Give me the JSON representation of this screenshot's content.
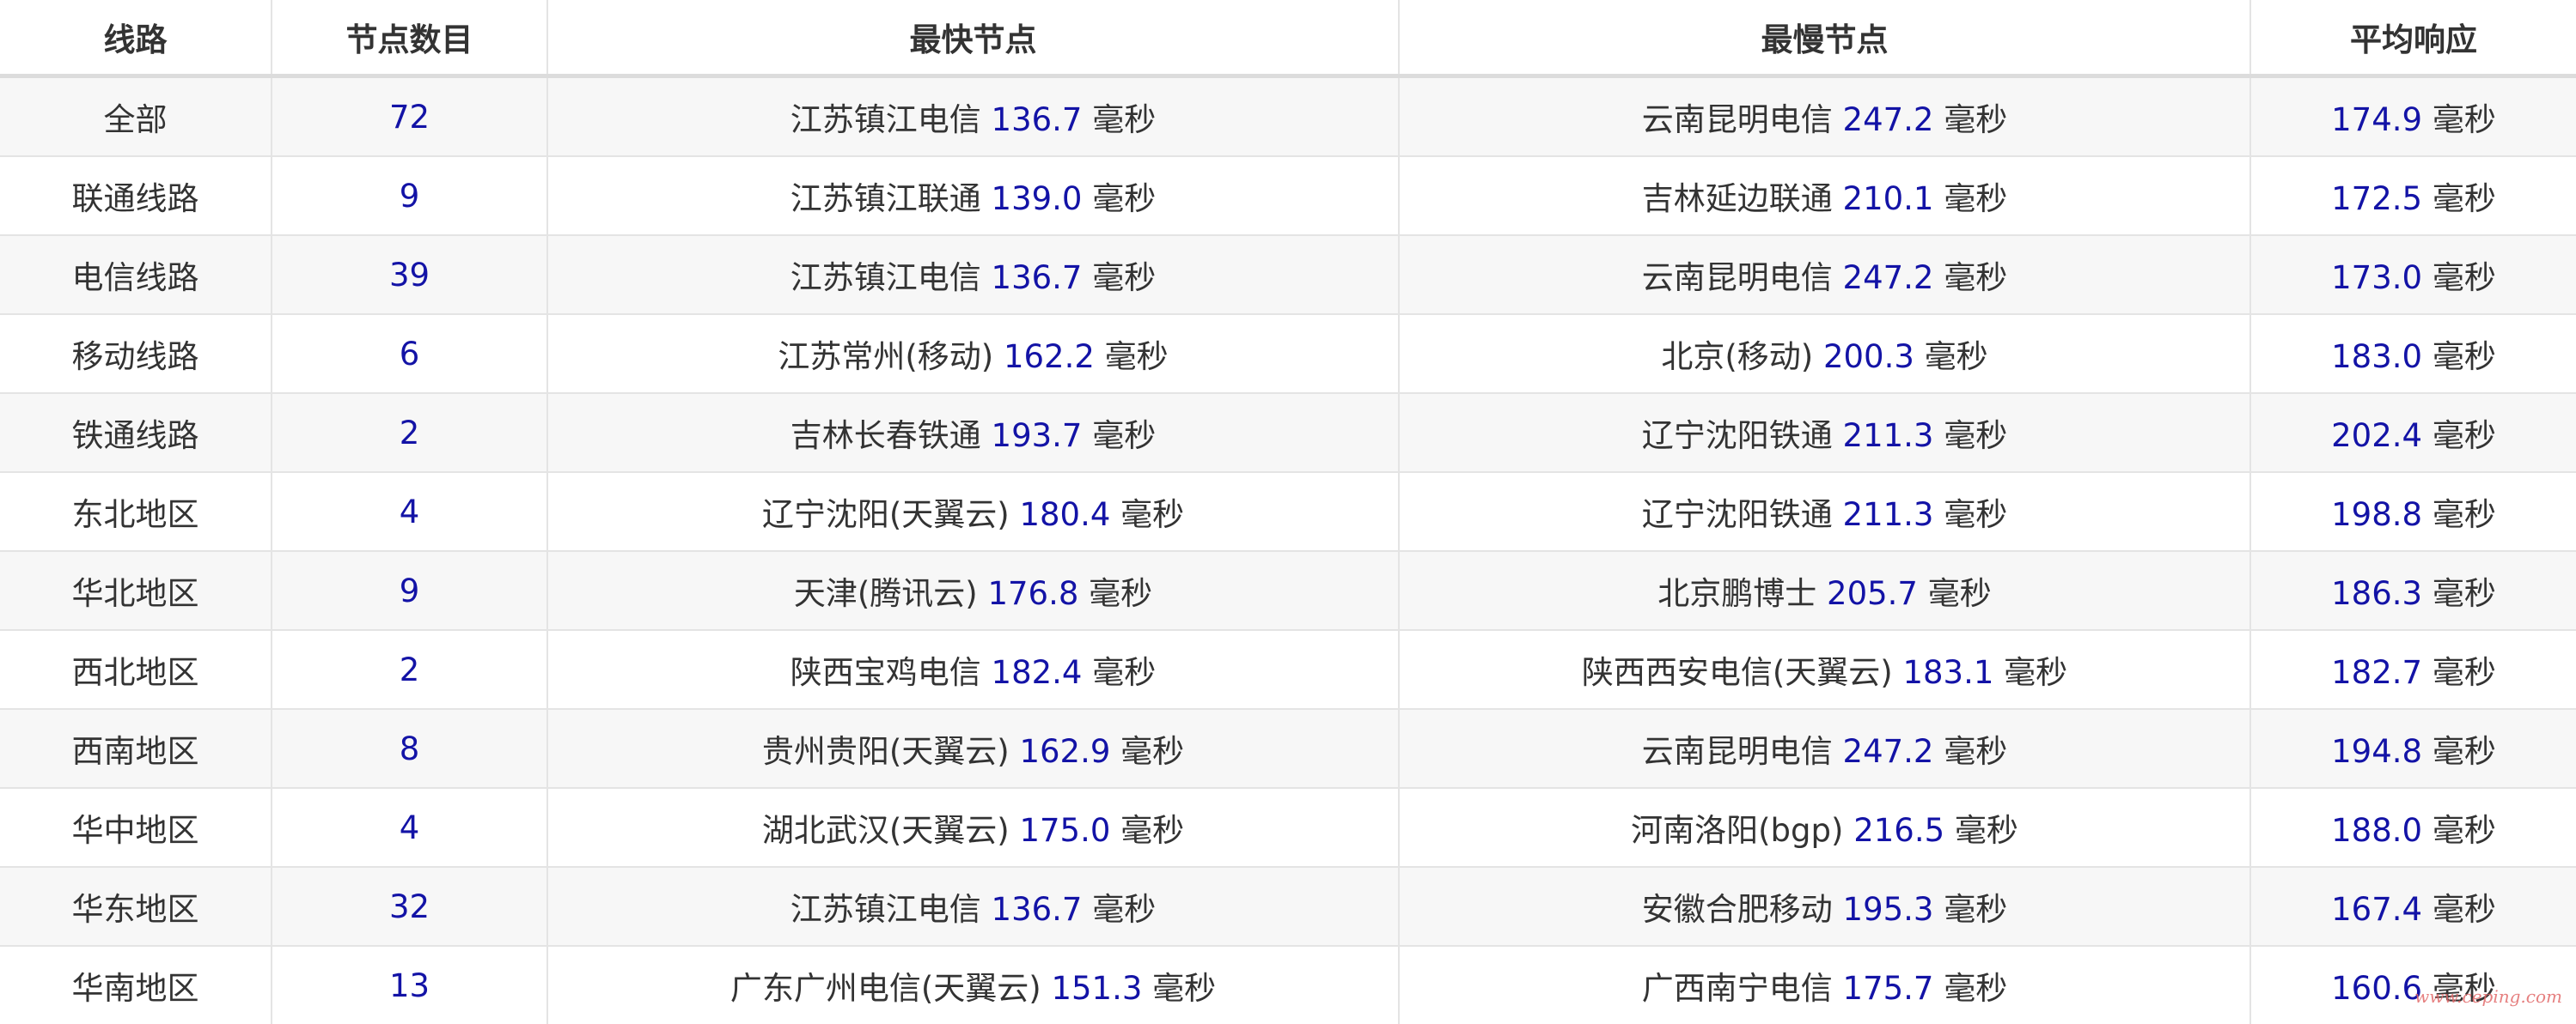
{
  "headers": [
    "线路",
    "节点数目",
    "最快节点",
    "最慢节点",
    "平均响应"
  ],
  "unit": "毫秒",
  "colors": {
    "value": "#1313a6",
    "text": "#333333",
    "stripe": "#f7f7f7",
    "border": "#e4e4e4"
  },
  "rows": [
    {
      "line": "全部",
      "count": "72",
      "fastest_name": "江苏镇江电信",
      "fastest_ms": "136.7",
      "slowest_name": "云南昆明电信",
      "slowest_ms": "247.2",
      "avg_ms": "174.9"
    },
    {
      "line": "联通线路",
      "count": "9",
      "fastest_name": "江苏镇江联通",
      "fastest_ms": "139.0",
      "slowest_name": "吉林延边联通",
      "slowest_ms": "210.1",
      "avg_ms": "172.5"
    },
    {
      "line": "电信线路",
      "count": "39",
      "fastest_name": "江苏镇江电信",
      "fastest_ms": "136.7",
      "slowest_name": "云南昆明电信",
      "slowest_ms": "247.2",
      "avg_ms": "173.0"
    },
    {
      "line": "移动线路",
      "count": "6",
      "fastest_name": "江苏常州(移动)",
      "fastest_ms": "162.2",
      "slowest_name": "北京(移动)",
      "slowest_ms": "200.3",
      "avg_ms": "183.0"
    },
    {
      "line": "铁通线路",
      "count": "2",
      "fastest_name": "吉林长春铁通",
      "fastest_ms": "193.7",
      "slowest_name": "辽宁沈阳铁通",
      "slowest_ms": "211.3",
      "avg_ms": "202.4"
    },
    {
      "line": "东北地区",
      "count": "4",
      "fastest_name": "辽宁沈阳(天翼云)",
      "fastest_ms": "180.4",
      "slowest_name": "辽宁沈阳铁通",
      "slowest_ms": "211.3",
      "avg_ms": "198.8"
    },
    {
      "line": "华北地区",
      "count": "9",
      "fastest_name": "天津(腾讯云)",
      "fastest_ms": "176.8",
      "slowest_name": "北京鹏博士",
      "slowest_ms": "205.7",
      "avg_ms": "186.3"
    },
    {
      "line": "西北地区",
      "count": "2",
      "fastest_name": "陕西宝鸡电信",
      "fastest_ms": "182.4",
      "slowest_name": "陕西西安电信(天翼云)",
      "slowest_ms": "183.1",
      "avg_ms": "182.7"
    },
    {
      "line": "西南地区",
      "count": "8",
      "fastest_name": "贵州贵阳(天翼云)",
      "fastest_ms": "162.9",
      "slowest_name": "云南昆明电信",
      "slowest_ms": "247.2",
      "avg_ms": "194.8"
    },
    {
      "line": "华中地区",
      "count": "4",
      "fastest_name": "湖北武汉(天翼云)",
      "fastest_ms": "175.0",
      "slowest_name": "河南洛阳(bgp)",
      "slowest_ms": "216.5",
      "avg_ms": "188.0"
    },
    {
      "line": "华东地区",
      "count": "32",
      "fastest_name": "江苏镇江电信",
      "fastest_ms": "136.7",
      "slowest_name": "安徽合肥移动",
      "slowest_ms": "195.3",
      "avg_ms": "167.4"
    },
    {
      "line": "华南地区",
      "count": "13",
      "fastest_name": "广东广州电信(天翼云)",
      "fastest_ms": "151.3",
      "slowest_name": "广西南宁电信",
      "slowest_ms": "175.7",
      "avg_ms": "160.6"
    }
  ],
  "watermark": "www.ceping.com"
}
